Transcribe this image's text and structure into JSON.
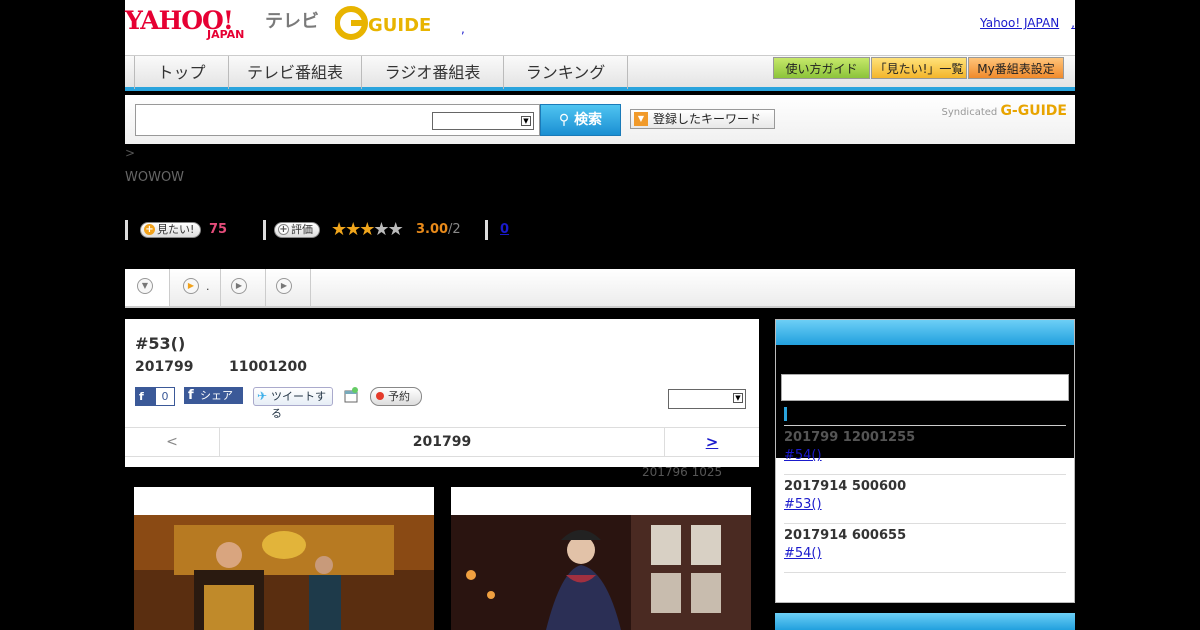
{
  "header": {
    "logo_text": "YAHOO!",
    "logo_sub": "JAPAN",
    "service_name": "テレビ",
    "gguide_logo": "G-GUIDE",
    "yj_link": "Yahoo! JAPAN",
    "yj_link_suffix": ","
  },
  "nav": {
    "tabs": [
      "トップ",
      "テレビ番組表",
      "ラジオ番組表",
      "ランキング"
    ],
    "buttons": [
      "使い方ガイド",
      "「見たい!」一覧",
      "My番組表設定"
    ]
  },
  "search": {
    "input_value": "",
    "select_value": "",
    "search_label": "検索",
    "keyword_label": "登録したキーワード",
    "syndicated_label": "Syndicated",
    "syndicated_logo": "G-GUIDE"
  },
  "breadcrumb": " >",
  "station": "WOWOW",
  "stats": {
    "want_label": "見たい!",
    "want_count": "75",
    "rate_label": "評価",
    "rating": 3.0,
    "rating_max": 5,
    "score": "3.00",
    "score_denom": "/2",
    "comments": "0"
  },
  "tabs": {
    "items": [
      {
        "icon": "chevron-down-icon",
        "label": ""
      },
      {
        "icon": "play-icon",
        "label": "."
      },
      {
        "icon": "play-icon",
        "label": ""
      },
      {
        "icon": "play-icon",
        "label": ""
      }
    ]
  },
  "episode": {
    "title": "#53()",
    "date": "201799",
    "time": "11001200",
    "fb_like_count": "0",
    "fb_share_label": "シェア",
    "tweet_label": "ツイートする",
    "reserve_label": "予約",
    "select_value": ""
  },
  "pager": {
    "prev": "<",
    "current": "201799",
    "next": ">"
  },
  "update_note": "201796  1025",
  "sidebar": {
    "search_value": "",
    "items": [
      {
        "date": "201799  12001255",
        "link": "#54()"
      },
      {
        "date": "2017914  500600",
        "link": "#53()"
      },
      {
        "date": "2017914  600655",
        "link": "#54()"
      }
    ]
  },
  "colors": {
    "accent": "#2aa4dd",
    "brand_red": "#e60033",
    "star": "#f1a61c"
  }
}
